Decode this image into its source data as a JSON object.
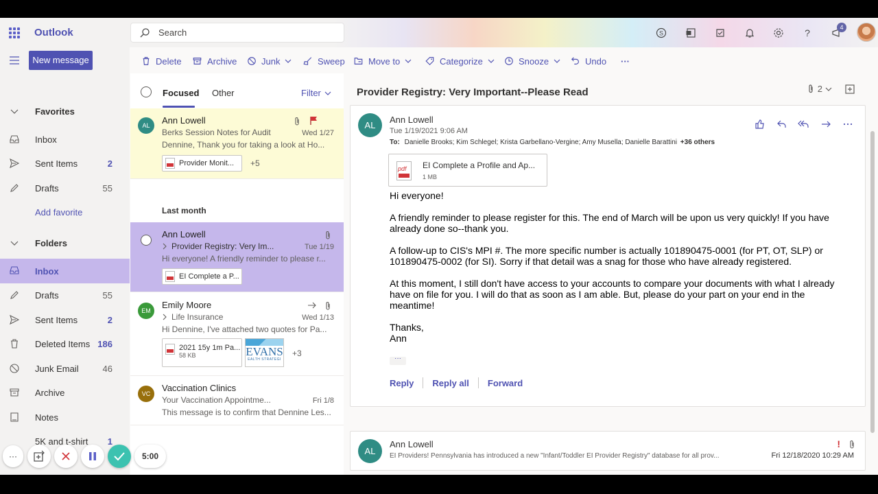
{
  "app": {
    "name": "Outlook"
  },
  "search": {
    "placeholder": "Search"
  },
  "header": {
    "notification_count": "4"
  },
  "nav": {
    "new_message": "New message",
    "favorites": {
      "title": "Favorites",
      "items": [
        {
          "label": "Inbox",
          "count": ""
        },
        {
          "label": "Sent Items",
          "count": "2"
        },
        {
          "label": "Drafts",
          "count": "55"
        }
      ],
      "add_favorite": "Add favorite"
    },
    "folders": {
      "title": "Folders",
      "items": [
        {
          "label": "Inbox",
          "count": ""
        },
        {
          "label": "Drafts",
          "count": "55"
        },
        {
          "label": "Sent Items",
          "count": "2"
        },
        {
          "label": "Deleted Items",
          "count": "186"
        },
        {
          "label": "Junk Email",
          "count": "46"
        },
        {
          "label": "Archive",
          "count": ""
        },
        {
          "label": "Notes",
          "count": ""
        },
        {
          "label": "5K and t-shirt",
          "count": "1"
        }
      ]
    }
  },
  "commands": {
    "delete": "Delete",
    "archive": "Archive",
    "junk": "Junk",
    "sweep": "Sweep",
    "move_to": "Move to",
    "categorize": "Categorize",
    "snooze": "Snooze",
    "undo": "Undo",
    "more": "···"
  },
  "list": {
    "tab_focused": "Focused",
    "tab_other": "Other",
    "filter": "Filter",
    "group_last_month": "Last month",
    "messages": [
      {
        "initials": "AL",
        "from": "Ann Lowell",
        "subject": "Berks Session Notes for Audit",
        "date": "Wed 1/27",
        "preview": "Dennine, Thank you for taking a look at Ho...",
        "attachment": "Provider Monit...",
        "extra": "+5"
      },
      {
        "initials": "",
        "from": "Ann Lowell",
        "subject": "Provider Registry: Very Im...",
        "date": "Tue 1/19",
        "preview": "Hi everyone! A friendly reminder to please r...",
        "attachment": "EI Complete a P..."
      },
      {
        "initials": "EM",
        "from": "Emily Moore",
        "subject": "Life Insurance",
        "date": "Wed 1/13",
        "preview": "Hi Dennine, I've attached two quotes for Pa...",
        "attachment": "2021 15y 1m Pa...",
        "attachment_size": "58 KB",
        "image_text": "EVANS",
        "image_subtext": "EALTH STRATEGI",
        "extra": "+3"
      },
      {
        "initials": "VC",
        "from": "Vaccination Clinics",
        "subject": "Your Vaccination Appointme...",
        "date": "Fri 1/8",
        "preview": "This message is to confirm that Dennine Les..."
      }
    ]
  },
  "reader": {
    "subject": "Provider Registry: Very Important--Please Read",
    "attach_count": "2",
    "email": {
      "initials": "AL",
      "from": "Ann Lowell",
      "sent": "Tue 1/19/2021 9:06 AM",
      "to_label": "To:",
      "to": "Danielle Brooks; Kim Schlegel; Krista Garbellano-Vergine; Amy Musella; Danielle Barattini",
      "to_more": "+36 others",
      "attachment_name": "EI Complete a Profile and Ap...",
      "attachment_size": "1 MB",
      "pdf_label": "pdf",
      "body": [
        "Hi everyone!",
        "A friendly reminder to please register for this.  The end of March will be upon us very quickly!  If you have already done so--thank you.",
        "A follow-up to CIS's MPI #.  The more specific number is actually 101890475-0001 (for PT, OT, SLP) or 101890475-0002 (for SI).  Sorry if that detail was a snag for those who have already registered.",
        "At this moment, I still don't have access to your accounts to compare your documents with what I already have on file for you.  I will do that as soon as I am able.  But, please do your part on your end in the meantime!",
        "Thanks,",
        "Ann"
      ],
      "more": "···",
      "reply": "Reply",
      "reply_all": "Reply all",
      "forward": "Forward"
    },
    "older": {
      "initials": "AL",
      "from": "Ann Lowell",
      "importance": "!",
      "snippet": "EI Providers! Pennsylvania has introduced a new \"Infant/Toddler EI Provider Registry\" database for all prov...",
      "date": "Fri 12/18/2020 10:29 AM"
    }
  },
  "recorder": {
    "time": "5:00",
    "more": "···"
  },
  "colors": {
    "brand": "#4f52b2",
    "selected": "#c5b7eb",
    "flagged": "#fdfbd6"
  }
}
